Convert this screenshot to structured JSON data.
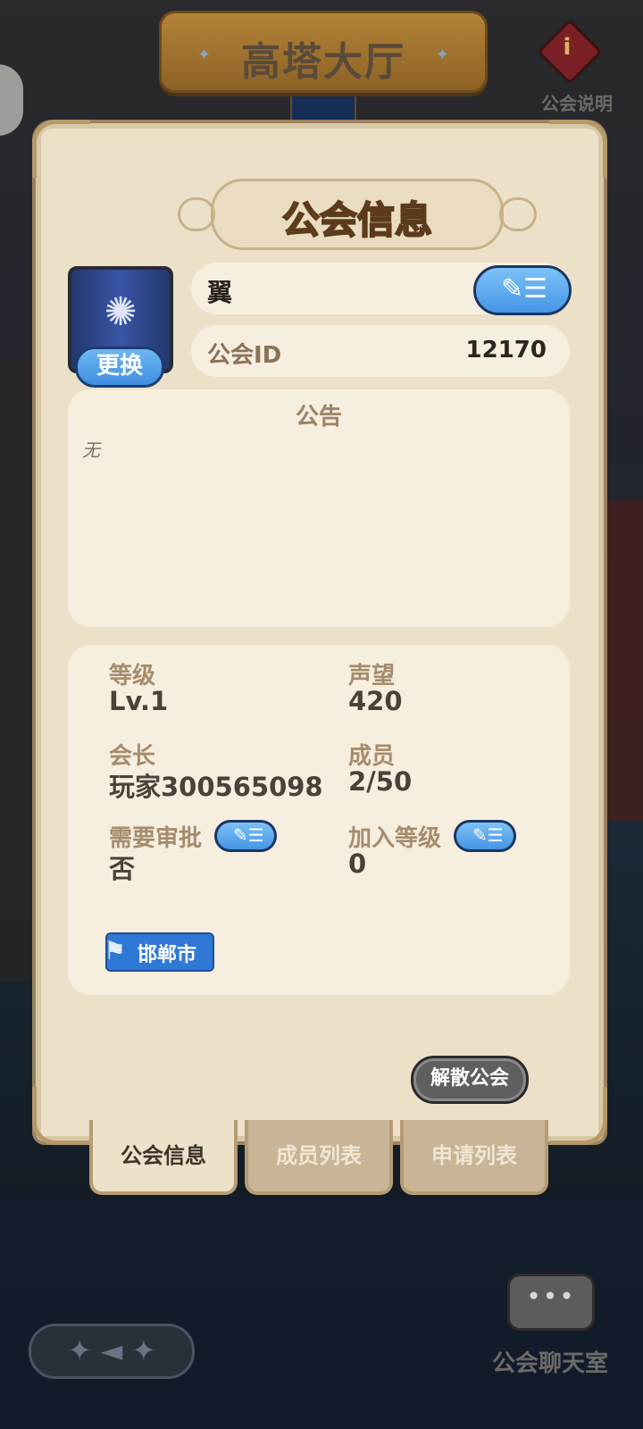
{
  "header": {
    "hall_title": "高塔大厅",
    "info_label": "公会说明"
  },
  "panel": {
    "title": "公会信息",
    "emblem_change_label": "更换",
    "guild_name": "翼",
    "id_label": "公会ID",
    "id_value": "12170",
    "notice": {
      "title": "公告",
      "text": "无"
    },
    "stats": {
      "level_label": "等级",
      "level_value": "Lv.1",
      "prestige_label": "声望",
      "prestige_value": "420",
      "leader_label": "会长",
      "leader_value": "玩家300565098",
      "members_label": "成员",
      "members_value": "2/50",
      "approval_label": "需要审批",
      "approval_value": "否",
      "join_level_label": "加入等级",
      "join_level_value": "0"
    },
    "city_tag": "邯郸市",
    "dissolve_button": "解散公会"
  },
  "tabs": [
    {
      "label": "公会信息",
      "active": true
    },
    {
      "label": "成员列表",
      "active": false
    },
    {
      "label": "申请列表",
      "active": false
    }
  ],
  "bottom": {
    "chat_label": "公会聊天室"
  },
  "colors": {
    "panel_bg": "#ece1c8",
    "accent_blue": "#4696e6",
    "title_orange": "#e58e3a",
    "city_tag_blue": "#2f78d6"
  },
  "icons": [
    "info-icon",
    "guild-emblem-icon",
    "edit-icon",
    "city-flag-icon",
    "back-arrow-icon",
    "chat-icon"
  ]
}
